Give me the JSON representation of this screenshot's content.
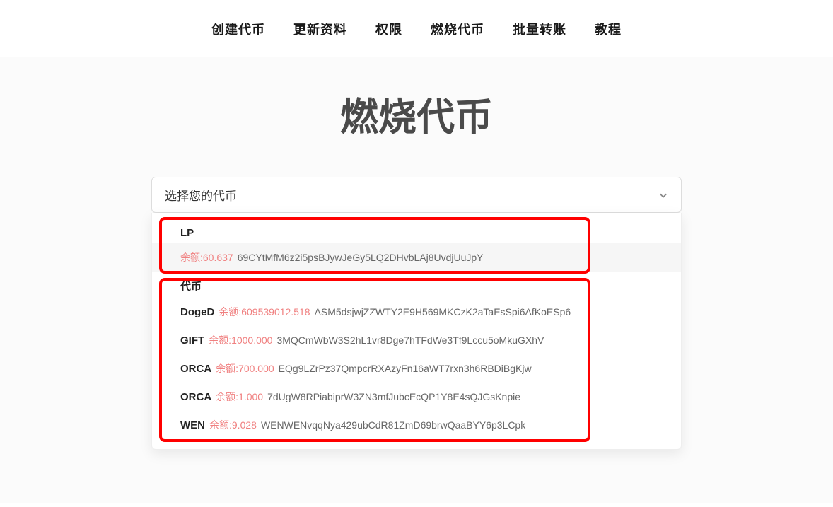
{
  "nav": {
    "items": [
      "创建代币",
      "更新资料",
      "权限",
      "燃烧代币",
      "批量转账",
      "教程"
    ]
  },
  "page": {
    "title": "燃烧代币"
  },
  "dropdown": {
    "placeholder": "选择您的代币",
    "balance_prefix": "余额:",
    "groups": [
      {
        "label": "LP",
        "options": [
          {
            "name": "",
            "balance": "60.637",
            "address": "69CYtMfM6z2i5psBJywJeGy5LQ2DHvbLAj8UvdjUuJpY",
            "hover": true
          }
        ]
      },
      {
        "label": "代币",
        "options": [
          {
            "name": "DogeD",
            "balance": "609539012.518",
            "address": "ASM5dsjwjZZWTY2E9H569MKCzK2aTaEsSpi6AfKoESp6",
            "hover": false
          },
          {
            "name": "GIFT",
            "balance": "1000.000",
            "address": "3MQCmWbW3S2hL1vr8Dge7hTFdWe3Tf9Lccu5oMkuGXhV",
            "hover": false
          },
          {
            "name": "ORCA",
            "balance": "700.000",
            "address": "EQg9LZrPz37QmpcrRXAzyFn16aWT7rxn3h6RBDiBgKjw",
            "hover": false
          },
          {
            "name": "ORCA",
            "balance": "1.000",
            "address": "7dUgW8RPiabiprW3ZN3mfJubcEcQP1Y8E4sQJGsKnpie",
            "hover": false
          },
          {
            "name": "WEN",
            "balance": "9.028",
            "address": "WENWENvqqNya429ubCdR81ZmD69brwQaaBYY6p3LCpk",
            "hover": false
          }
        ]
      }
    ]
  }
}
